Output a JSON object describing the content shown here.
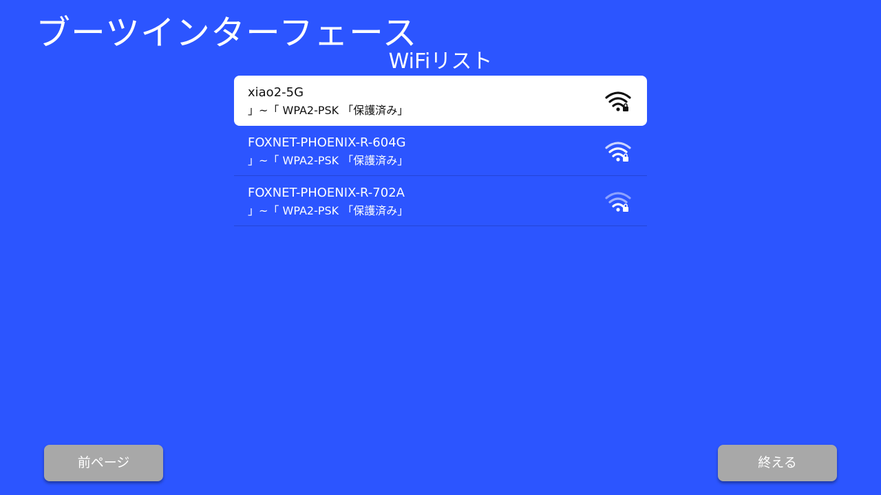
{
  "header": {
    "title": "ブーツインターフェース",
    "subtitle": "WiFiリスト"
  },
  "wifi_list": {
    "items": [
      {
        "ssid": "xiao2-5G",
        "security": "」~「 WPA2-PSK 「保護済み」",
        "selected": true,
        "icon": "wifi-strong-icon"
      },
      {
        "ssid": "FOXNET-PHOENIX-R-604G",
        "security": "」~「 WPA2-PSK 「保護済み」",
        "selected": false,
        "icon": "wifi-medium-icon"
      },
      {
        "ssid": "FOXNET-PHOENIX-R-702A",
        "security": "」~「 WPA2-PSK 「保護済み」",
        "selected": false,
        "icon": "wifi-weak-icon"
      }
    ]
  },
  "footer": {
    "prev_label": "前ページ",
    "finish_label": "終える"
  },
  "colors": {
    "background": "#2c55ff",
    "selected_row": "#ffffff",
    "button": "#a8a8a8"
  }
}
